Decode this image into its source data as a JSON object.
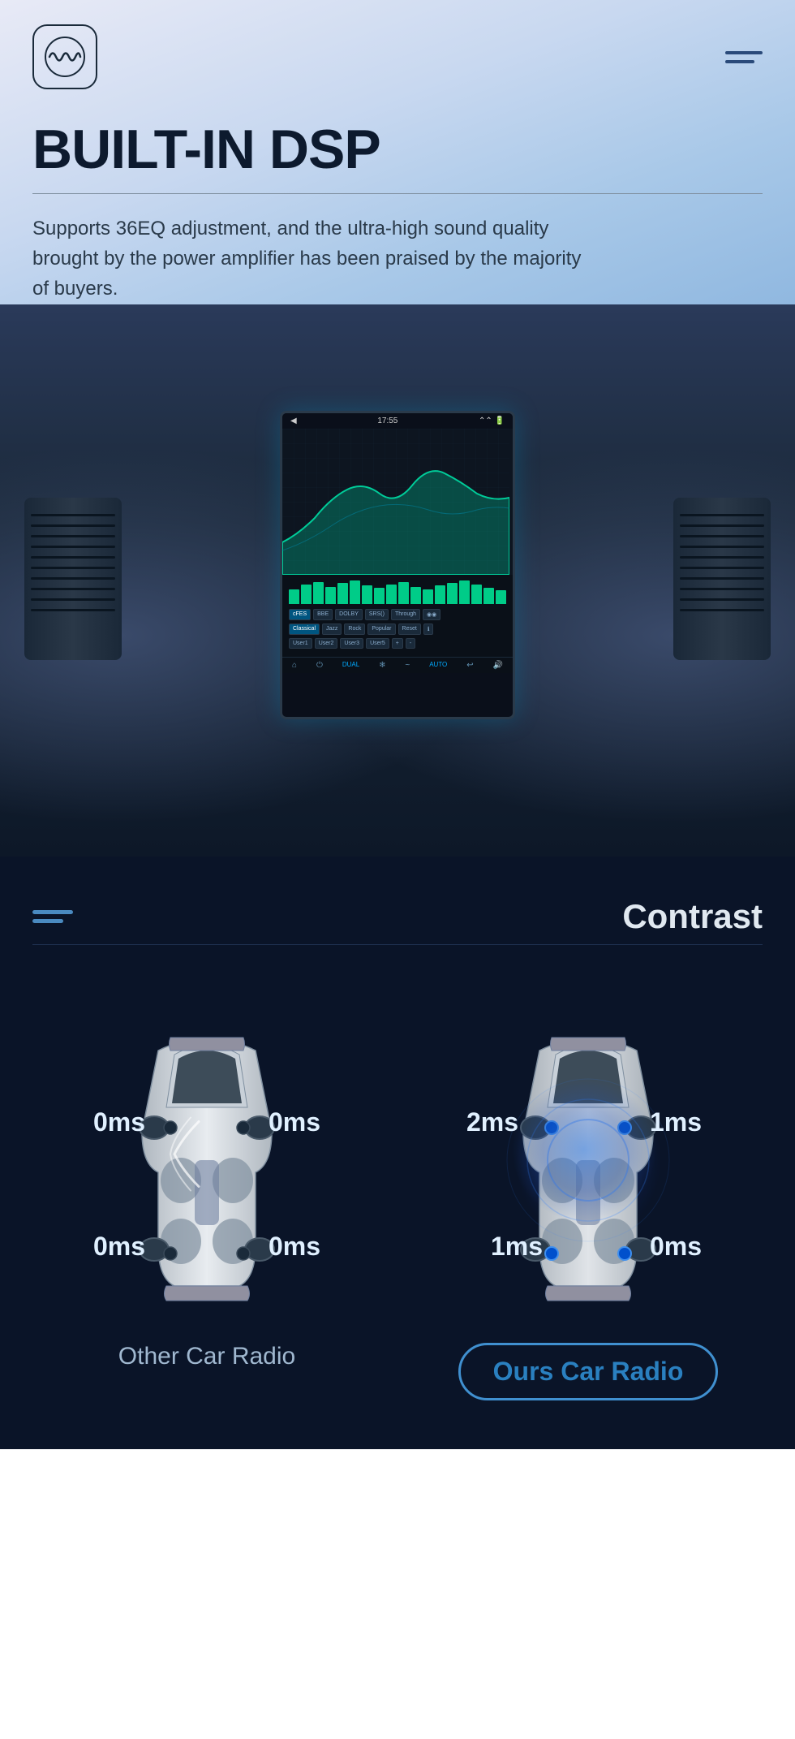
{
  "nav": {
    "logo_aria": "App Logo",
    "menu_aria": "Menu"
  },
  "hero": {
    "title": "BUILT-IN DSP",
    "description": "Supports 36EQ adjustment, and the ultra-high sound quality brought by the power amplifier has been praised by the majority of buyers."
  },
  "screen": {
    "time": "17:55",
    "eq_preset_buttons": [
      "cFES",
      "BBE",
      "DOLBY",
      "SRS()",
      "Through",
      "◉◉",
      "Classical",
      "Jazz",
      "Rock",
      "Popular",
      "Reset",
      "ℹ",
      "User1",
      "User2",
      "User3",
      "User5",
      "+",
      "-"
    ],
    "bottom_controls": [
      "⌂",
      "⏻",
      "DUAL",
      "❄",
      "≋≋",
      "AUTO",
      "↩",
      "🔊"
    ]
  },
  "contrast": {
    "section_label": "Contrast",
    "other_car": {
      "label": "Other Car Radio",
      "labels": {
        "top_left": "0ms",
        "top_right": "0ms",
        "bottom_left": "0ms",
        "bottom_right": "0ms"
      }
    },
    "ours_car": {
      "label": "Ours Car Radio",
      "labels": {
        "top_left": "2ms",
        "top_right": "1ms",
        "bottom_left": "1ms",
        "bottom_right": "0ms"
      }
    }
  }
}
